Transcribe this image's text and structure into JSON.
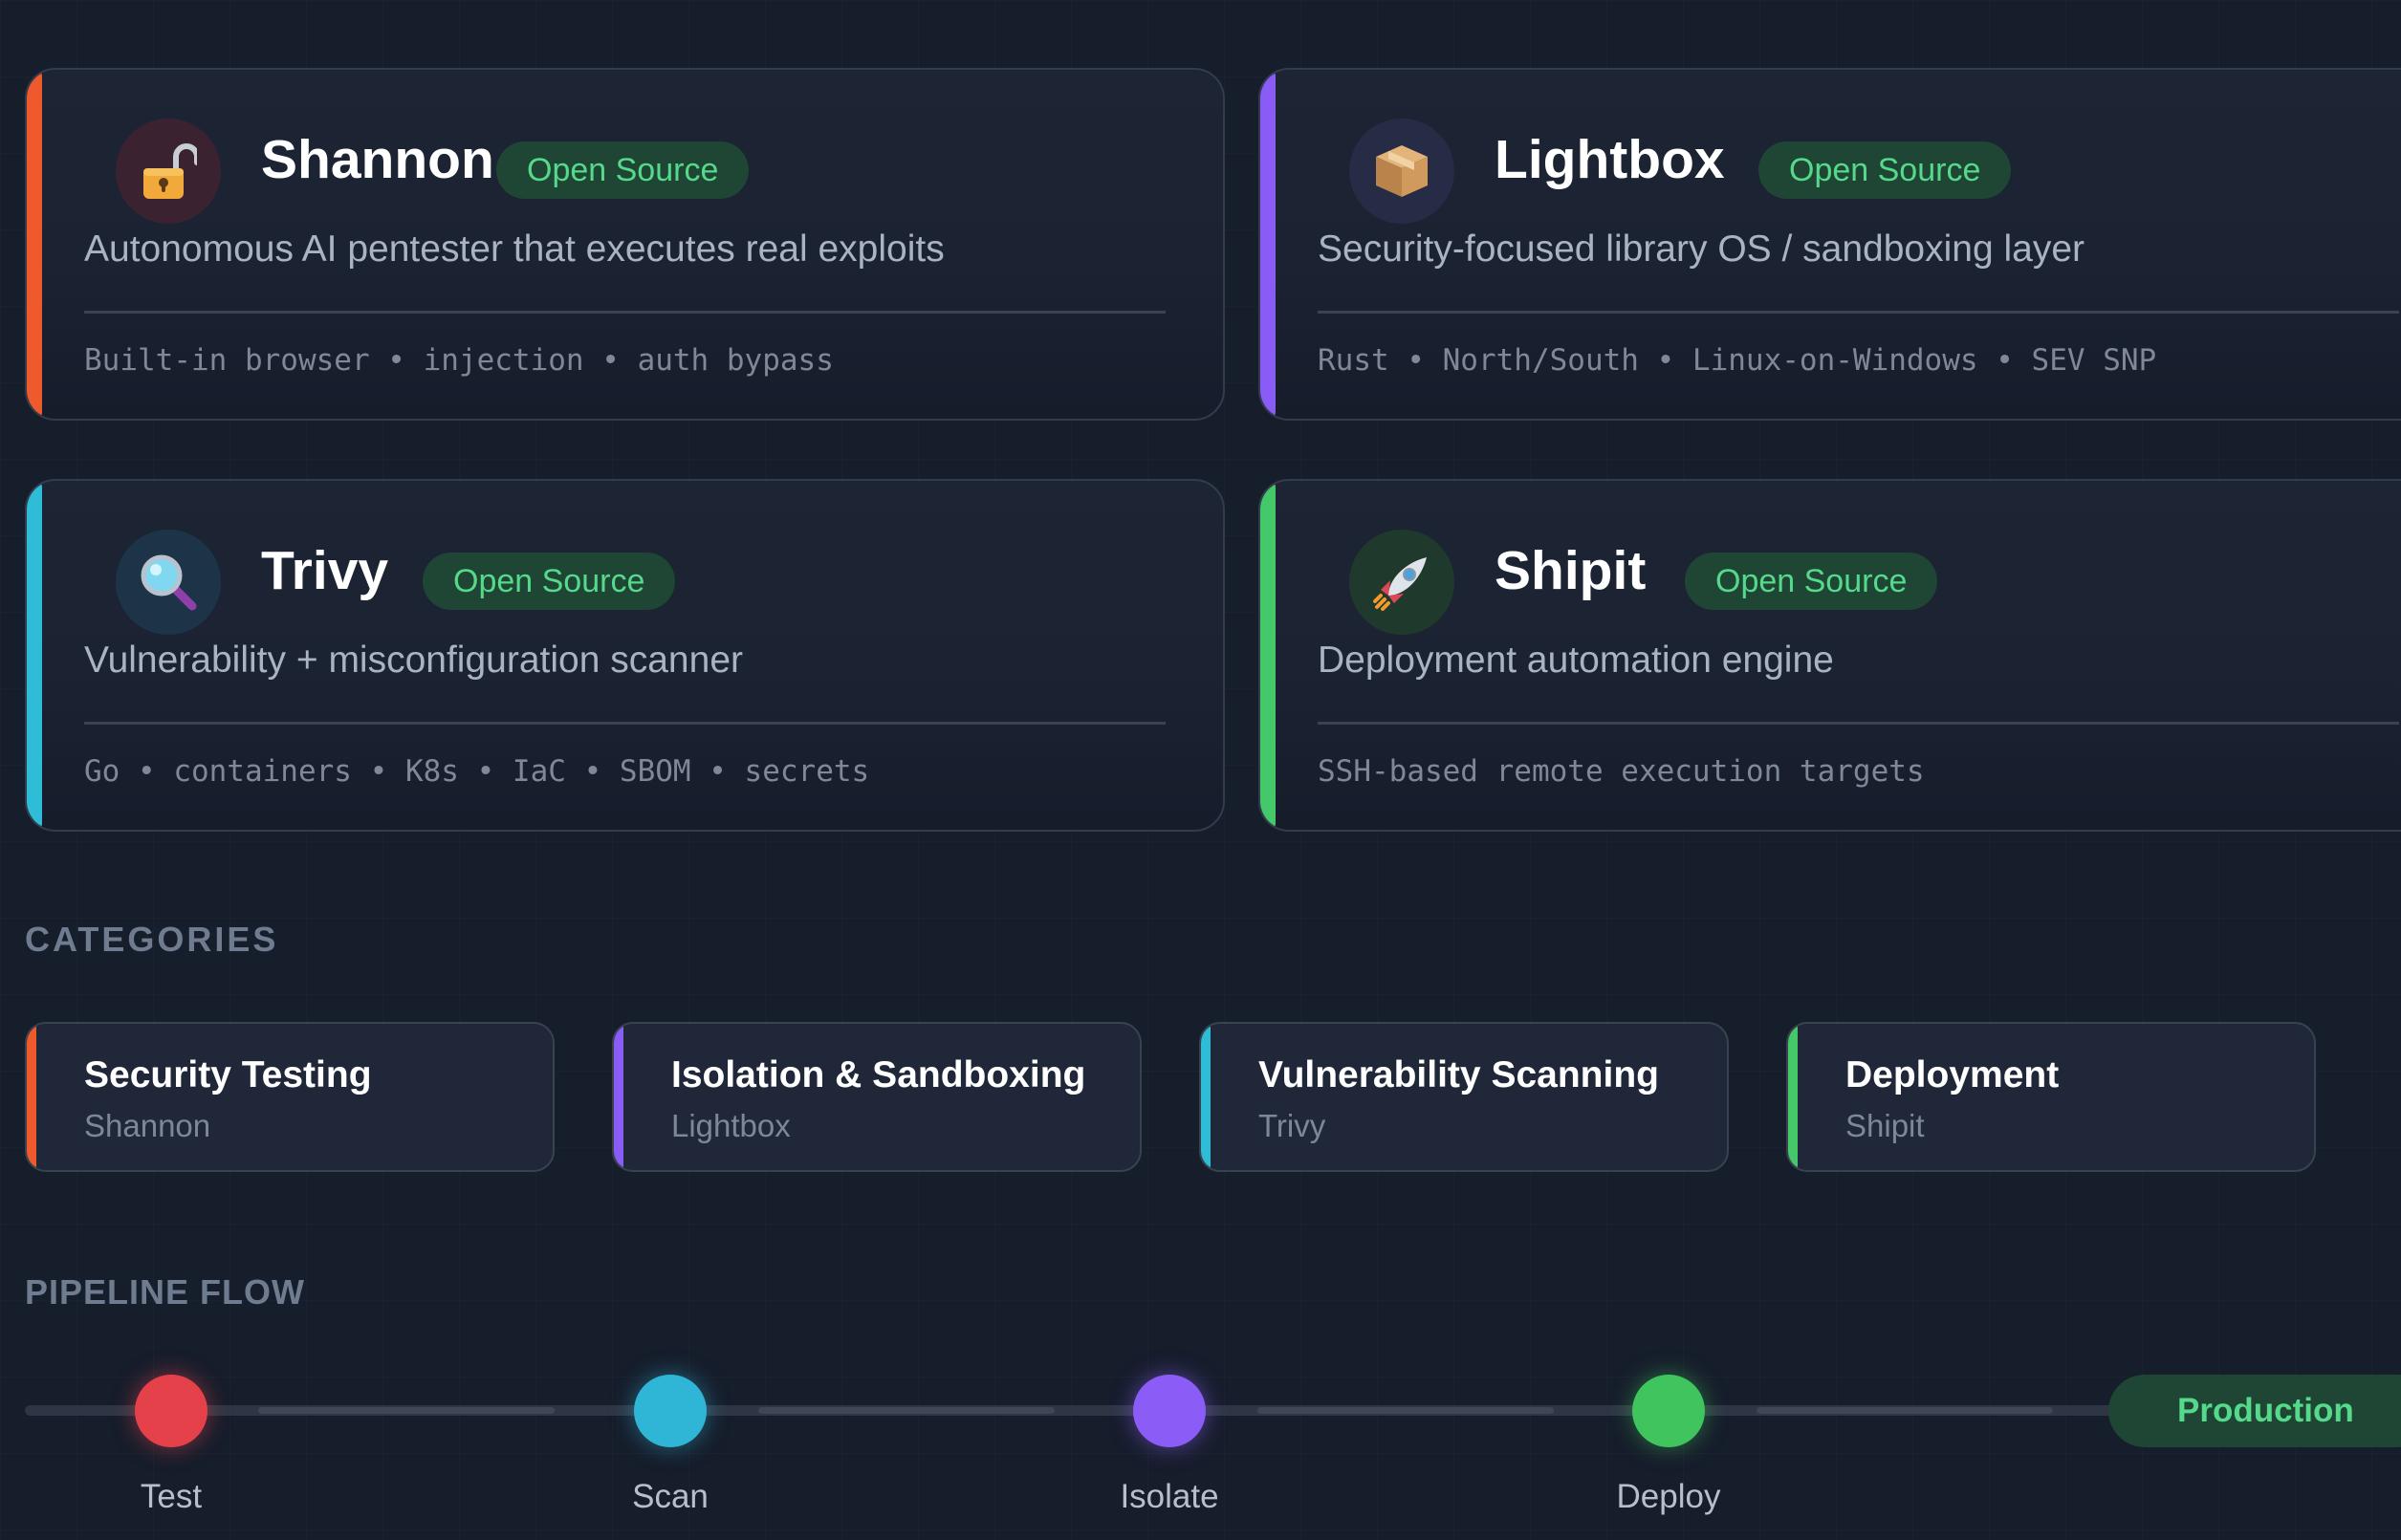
{
  "colors": {
    "shannon": "#ee5a2b",
    "lightbox": "#8a5cf6",
    "trivy": "#2fbcd7",
    "shipit": "#44c86a",
    "badge_bg": "#1f4534",
    "badge_text": "#55d98a"
  },
  "tools": [
    {
      "name": "Shannon",
      "icon": "unlocked-padlock-icon",
      "badge": "Open Source",
      "description": "Autonomous AI pentester that executes real exploits",
      "tags": "Built-in browser • injection • auth bypass"
    },
    {
      "name": "Lightbox",
      "icon": "package-box-icon",
      "badge": "Open Source",
      "description": "Security-focused library OS / sandboxing layer",
      "tags": "Rust • North/South • Linux-on-Windows • SEV SNP"
    },
    {
      "name": "Trivy",
      "icon": "magnifying-glass-icon",
      "badge": "Open Source",
      "description": "Vulnerability + misconfiguration scanner",
      "tags": "Go • containers • K8s • IaC • SBOM • secrets"
    },
    {
      "name": "Shipit",
      "icon": "rocket-icon",
      "badge": "Open Source",
      "description": "Deployment automation engine",
      "tags": "SSH-based remote execution targets"
    }
  ],
  "categories": {
    "title": "CATEGORIES",
    "items": [
      {
        "title": "Security Testing",
        "tool": "Shannon"
      },
      {
        "title": "Isolation & Sandboxing",
        "tool": "Lightbox"
      },
      {
        "title": "Vulnerability Scanning",
        "tool": "Trivy"
      },
      {
        "title": "Deployment",
        "tool": "Shipit"
      }
    ]
  },
  "pipeline": {
    "title": "PIPELINE FLOW",
    "steps": [
      {
        "label": "Test",
        "color": "#e5414a"
      },
      {
        "label": "Scan",
        "color": "#2fb6d6"
      },
      {
        "label": "Isolate",
        "color": "#8b5cf6"
      },
      {
        "label": "Deploy",
        "color": "#3fc45e"
      }
    ],
    "final": "Production"
  }
}
